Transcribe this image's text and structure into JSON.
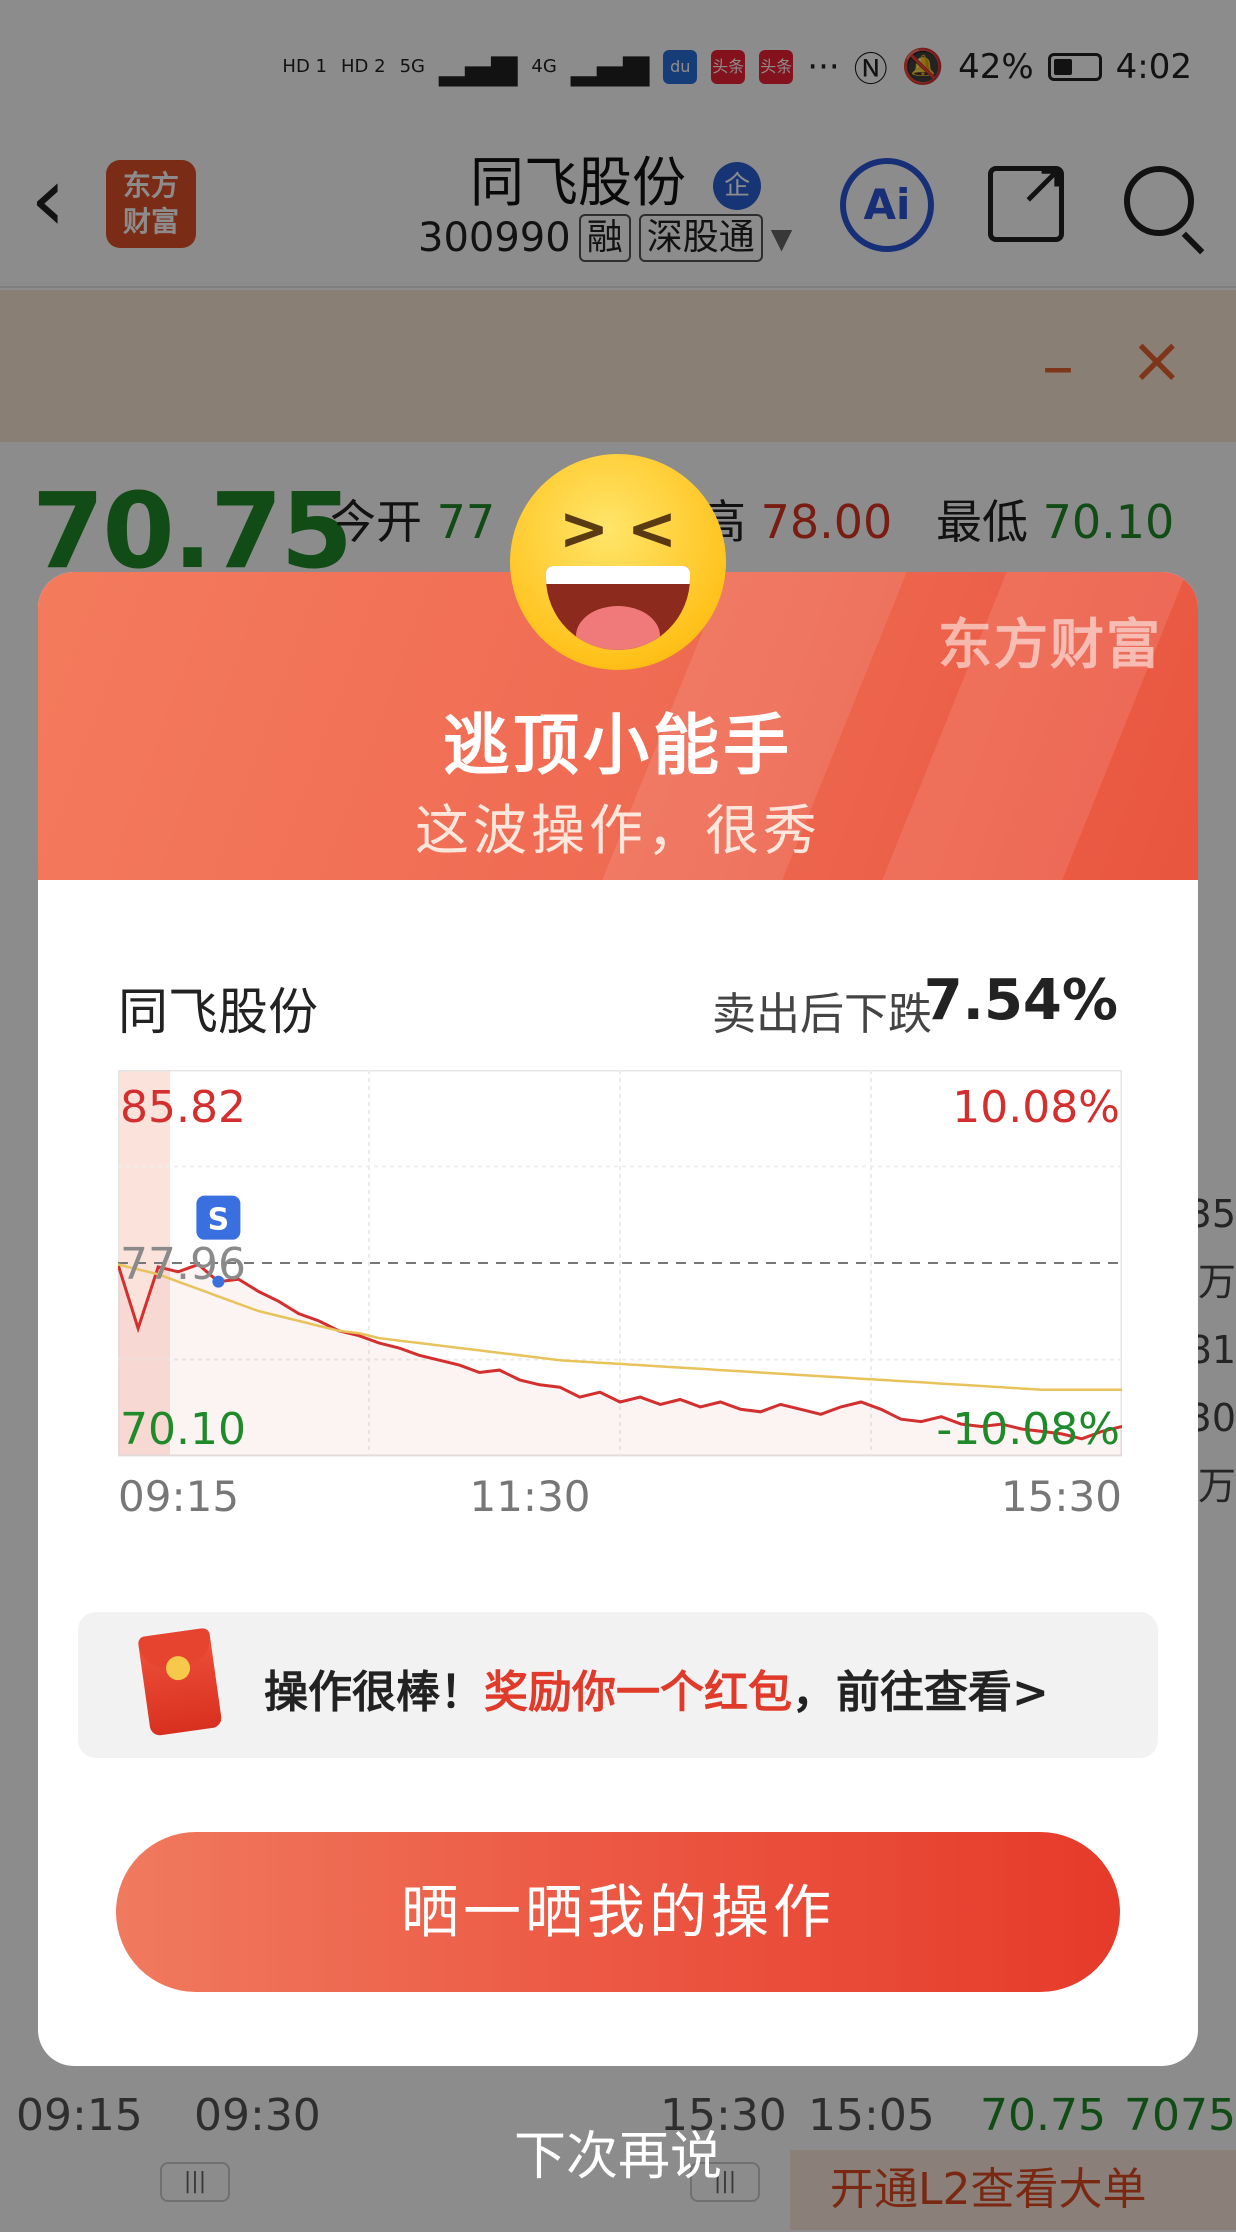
{
  "status_bar": {
    "signal_labels": [
      "HD 1",
      "HD 2",
      "5G",
      "4G"
    ],
    "app_chips": [
      "头条",
      "头条"
    ],
    "more": "···",
    "battery_pct": "42%",
    "time": "4:02"
  },
  "nav": {
    "back_glyph": "‹",
    "app_logo": "东方\n财富",
    "stock_name": "同飞股份",
    "qi_badge": "企",
    "stock_code": "300990",
    "tag_rong": "融",
    "tag_sgt": "深股通",
    "dropdown_glyph": "▼",
    "ai_label": "Ai"
  },
  "banner": {
    "minimize": "–",
    "close": "×"
  },
  "quote": {
    "price": "70.75",
    "open_label": "今开",
    "open_value": "77",
    "high_label": "高",
    "high_value": "78.00",
    "low_label": "最低",
    "low_value": "70.10"
  },
  "background_right_fragments": [
    "35",
    "万",
    "81",
    "30",
    "万"
  ],
  "bottom": {
    "t1": "09:15",
    "t2": "09:30",
    "t3": "15:30",
    "t4": "15:05",
    "price": "70.75",
    "vol": "7075",
    "l2_label": "开通L2查看大单",
    "scroll_glyph": "|||"
  },
  "modal": {
    "brand_watermark": "东方财富",
    "title": "逃顶小能手",
    "subtitle": "这波操作，很秀",
    "stock_name": "同飞股份",
    "drop_label": "卖出后下跌",
    "drop_value": "7.54%",
    "reward_prefix": "操作很棒！",
    "reward_highlight": "奖励你一个红包",
    "reward_suffix": "，前往查看>",
    "share_button": "晒一晒我的操作",
    "later_link": "下次再说"
  },
  "colors": {
    "up": "#d32f2f",
    "down": "#1f8a2a",
    "avg_line": "#e8c25a",
    "modal_header": "#ef6a52",
    "accent_blue": "#2b57d8"
  },
  "chart_data": {
    "type": "line",
    "title": "",
    "xlabel": "",
    "ylabel": "",
    "x_tick_labels": [
      "09:15",
      "11:30",
      "15:30"
    ],
    "y_top_label": "85.82",
    "y_mid_label": "77.96",
    "y_bottom_label": "70.10",
    "right_top_label": "10.08%",
    "right_bottom_label": "-10.08%",
    "ylim": [
      70.1,
      85.82
    ],
    "reference_price": 77.96,
    "sell_marker": {
      "label": "S",
      "time_index": 5,
      "price": 77.2
    },
    "grid": true,
    "series": [
      {
        "values": [
          77.9,
          75.3,
          77.8,
          77.6,
          77.9,
          77.2,
          77.3,
          76.8,
          76.4,
          75.9,
          75.6,
          75.2,
          75.0,
          74.7,
          74.5,
          74.2,
          74.0,
          73.8,
          73.5,
          73.6,
          73.2,
          73.0,
          72.9,
          72.5,
          72.7,
          72.3,
          72.5,
          72.2,
          72.4,
          72.1,
          72.3,
          72.0,
          71.9,
          72.2,
          72.0,
          71.8,
          72.1,
          72.3,
          72.0,
          71.6,
          71.5,
          71.7,
          71.4,
          71.3,
          71.4,
          71.2,
          71.1,
          71.0,
          70.8,
          71.1,
          71.3
        ]
      },
      {
        "values": [
          77.9,
          77.7,
          77.5,
          77.2,
          76.9,
          76.6,
          76.3,
          76.0,
          75.8,
          75.6,
          75.4,
          75.2,
          75.1,
          74.9,
          74.8,
          74.7,
          74.6,
          74.5,
          74.4,
          74.3,
          74.2,
          74.1,
          74.0,
          73.95,
          73.9,
          73.85,
          73.8,
          73.75,
          73.7,
          73.65,
          73.6,
          73.55,
          73.5,
          73.45,
          73.4,
          73.35,
          73.3,
          73.25,
          73.2,
          73.15,
          73.1,
          73.05,
          73.0,
          72.95,
          72.9,
          72.85,
          72.8,
          72.8,
          72.8,
          72.8,
          72.8
        ]
      }
    ]
  }
}
